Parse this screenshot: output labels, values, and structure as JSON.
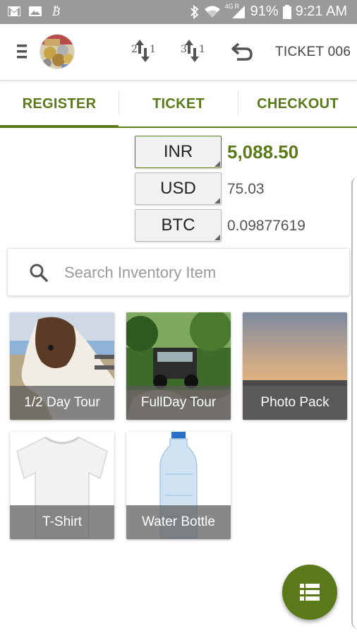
{
  "status_bar": {
    "battery": "91%",
    "time": "9:21 AM",
    "network_badge": "4G",
    "network_r": "R",
    "icons": [
      "gmail-icon",
      "image-icon",
      "bitcoin-icon",
      "bluetooth-icon",
      "wifi-icon",
      "signal-icon",
      "battery-icon"
    ]
  },
  "app_bar": {
    "ticket_title": "TICKET 006",
    "sort_asc_digit_top": "2",
    "sort_asc_digit_bottom": "1",
    "sort_desc_digit_top": "3",
    "sort_desc_digit_bottom": "1"
  },
  "tabs": [
    {
      "label": "REGISTER",
      "active": true
    },
    {
      "label": "TICKET",
      "active": false
    },
    {
      "label": "CHECKOUT",
      "active": false
    }
  ],
  "currencies": [
    {
      "code": "INR",
      "value": "5,088.50",
      "primary": true
    },
    {
      "code": "USD",
      "value": "75.03",
      "primary": false
    },
    {
      "code": "BTC",
      "value": "0.09877619",
      "primary": false
    }
  ],
  "search": {
    "placeholder": "Search Inventory Item",
    "value": ""
  },
  "items": [
    {
      "label": "1/2 Day Tour",
      "image": "horse"
    },
    {
      "label": "FullDay Tour",
      "image": "jeep"
    },
    {
      "label": "Photo Pack",
      "image": "sunset"
    },
    {
      "label": "T-Shirt",
      "image": "tshirt"
    },
    {
      "label": "Water Bottle",
      "image": "bottle"
    }
  ],
  "colors": {
    "accent": "#5a7a1a",
    "status_bar": "#9a9a9a"
  }
}
